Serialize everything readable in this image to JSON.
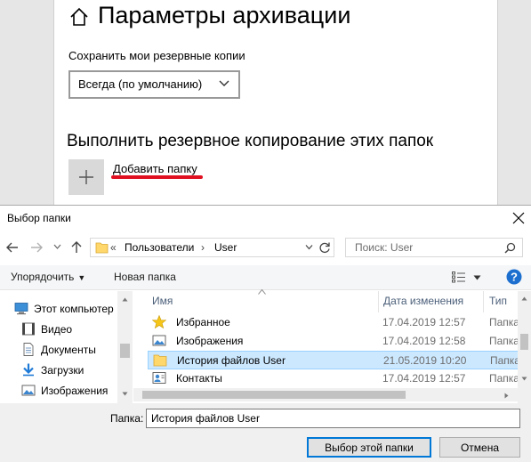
{
  "settings": {
    "title": "Параметры архивации",
    "keep_label": "Сохранить мои резервные копии",
    "keep_value": "Всегда (по умолчанию)",
    "section_title": "Выполнить резервное копирование этих папок",
    "add_folder": "Добавить папку"
  },
  "dialog": {
    "title": "Выбор папки",
    "address": {
      "overflow": "«",
      "segments": [
        "Пользователи",
        "User"
      ],
      "separator": "›"
    },
    "search_placeholder": "Поиск: User",
    "toolbar": {
      "organize": "Упорядочить",
      "new_folder": "Новая папка"
    },
    "nav_items": [
      {
        "label": "Этот компьютер",
        "icon": "computer-icon"
      },
      {
        "label": "Видео",
        "icon": "video-icon"
      },
      {
        "label": "Документы",
        "icon": "documents-icon"
      },
      {
        "label": "Загрузки",
        "icon": "downloads-icon"
      },
      {
        "label": "Изображения",
        "icon": "pictures-icon"
      }
    ],
    "columns": [
      "Имя",
      "Дата изменения",
      "Тип"
    ],
    "files": [
      {
        "name": "Избранное",
        "date": "17.04.2019 12:57",
        "type": "Папка",
        "icon": "star-folder-icon",
        "selected": false
      },
      {
        "name": "Изображения",
        "date": "17.04.2019 12:58",
        "type": "Папка",
        "icon": "pictures-folder-icon",
        "selected": false
      },
      {
        "name": "История файлов User",
        "date": "21.05.2019 10:20",
        "type": "Папка",
        "icon": "folder-icon",
        "selected": true
      },
      {
        "name": "Контакты",
        "date": "17.04.2019 12:57",
        "type": "Папка",
        "icon": "contacts-folder-icon",
        "selected": false
      }
    ],
    "folder_label": "Папка:",
    "folder_value": "История файлов User",
    "select_button": "Выбор этой папки",
    "cancel_button": "Отмена"
  },
  "colors": {
    "accent": "#0078d7",
    "selection": "#cce8ff",
    "highlight_underline": "#e01020"
  }
}
